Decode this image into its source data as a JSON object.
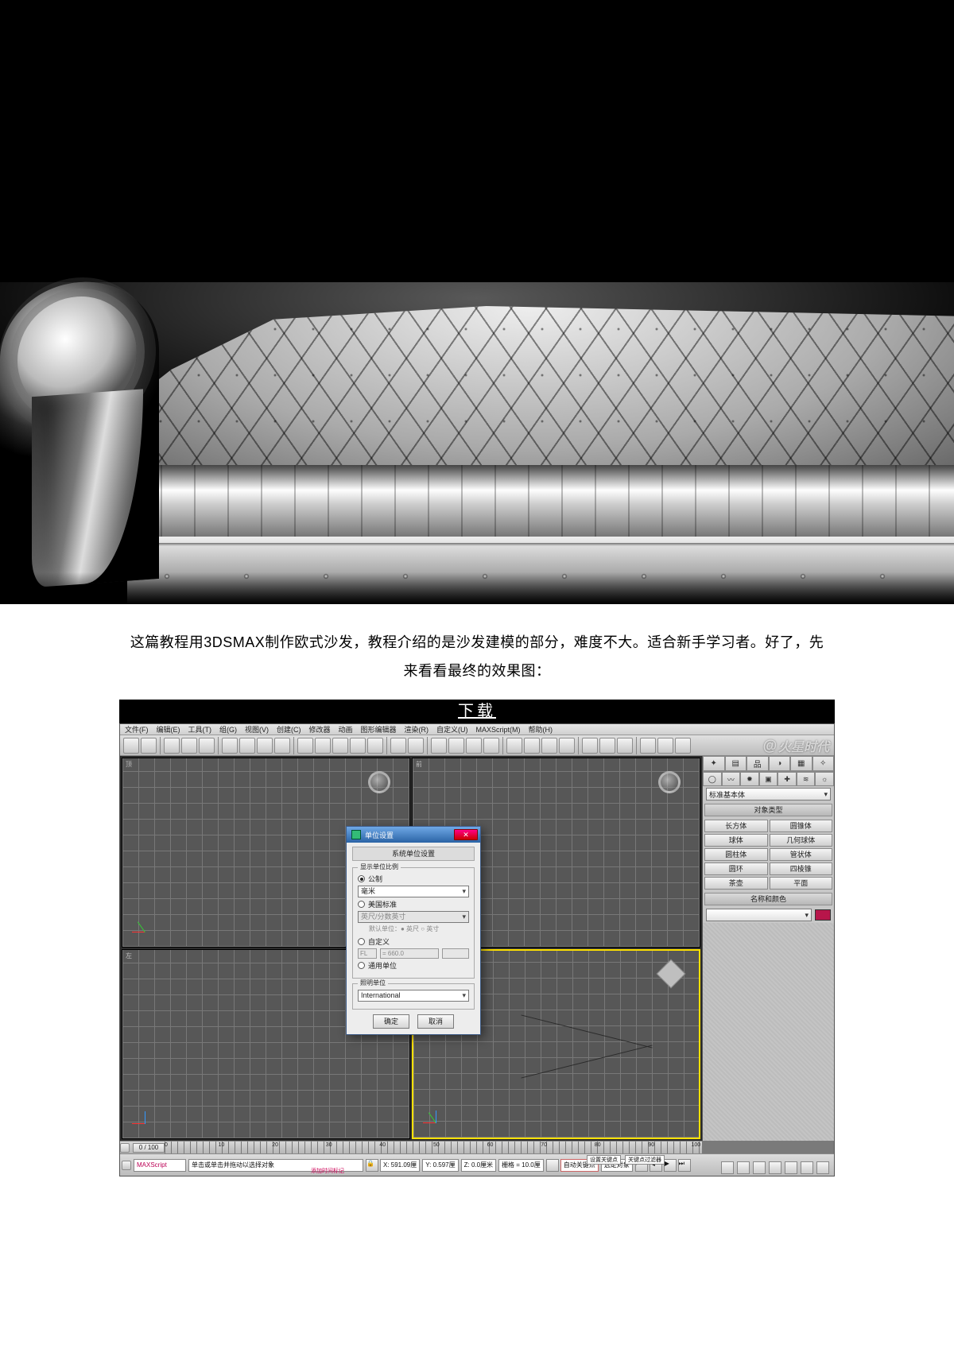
{
  "caption": {
    "line1": "这篇教程用3DSMAX制作欧式沙发，教程介绍的是沙发建模的部分，难度不大。适合新手学习者。好了，先",
    "line2": "来看看最终的效果图："
  },
  "download": {
    "label": "下载"
  },
  "max": {
    "menus": [
      "文件(F)",
      "编辑(E)",
      "工具(T)",
      "组(G)",
      "视图(V)",
      "创建(C)",
      "修改器",
      "动画",
      "图形编辑器",
      "渲染(R)",
      "自定义(U)",
      "MAXScript(M)",
      "帮助(H)"
    ],
    "watermark": "火星时代",
    "cmd": {
      "dropdown": "标准基本体",
      "rollout1": "对象类型",
      "objects": [
        "长方体",
        "圆锥体",
        "球体",
        "几何球体",
        "圆柱体",
        "管状体",
        "圆环",
        "四棱锥",
        "茶壶",
        "平面"
      ],
      "rollout2": "名称和颜色"
    },
    "dialog": {
      "title": "单位设置",
      "hdr": "系统单位设置",
      "grp1": "显示单位比例",
      "radio_metric": "公制",
      "metric_value": "毫米",
      "radio_us": "美国标准",
      "us_sub1": "英尺/分数英寸",
      "us_sub2": "默认单位：● 英尺 ○ 英寸",
      "radio_custom": "自定义",
      "custom_fl": "FL",
      "custom_val": "= 660.0",
      "radio_generic": "通用单位",
      "grp2": "照明单位",
      "lighting": "International",
      "ok": "确定",
      "cancel": "取消"
    },
    "timeline": {
      "scrub": "0 / 100",
      "t0": "0",
      "t1": "10",
      "t2": "20",
      "t3": "30",
      "t4": "40",
      "t5": "50",
      "t6": "60",
      "t7": "70",
      "t8": "80",
      "t9": "90",
      "t10": "100"
    },
    "status": {
      "script": "MAXScript",
      "hint": "单击或单击并拖动以选择对象",
      "lock": "🔒",
      "x": "X: 591.09厘",
      "y": "Y: 0.597厘",
      "z": "Z: 0.0厘米",
      "grid": "栅格 = 10.0厘",
      "autokey": "自动关键点",
      "selset": "选定对象",
      "setkey": "设置关键点",
      "keyfilter": "关键点过滤器",
      "addtime": "添加时间标记"
    }
  }
}
